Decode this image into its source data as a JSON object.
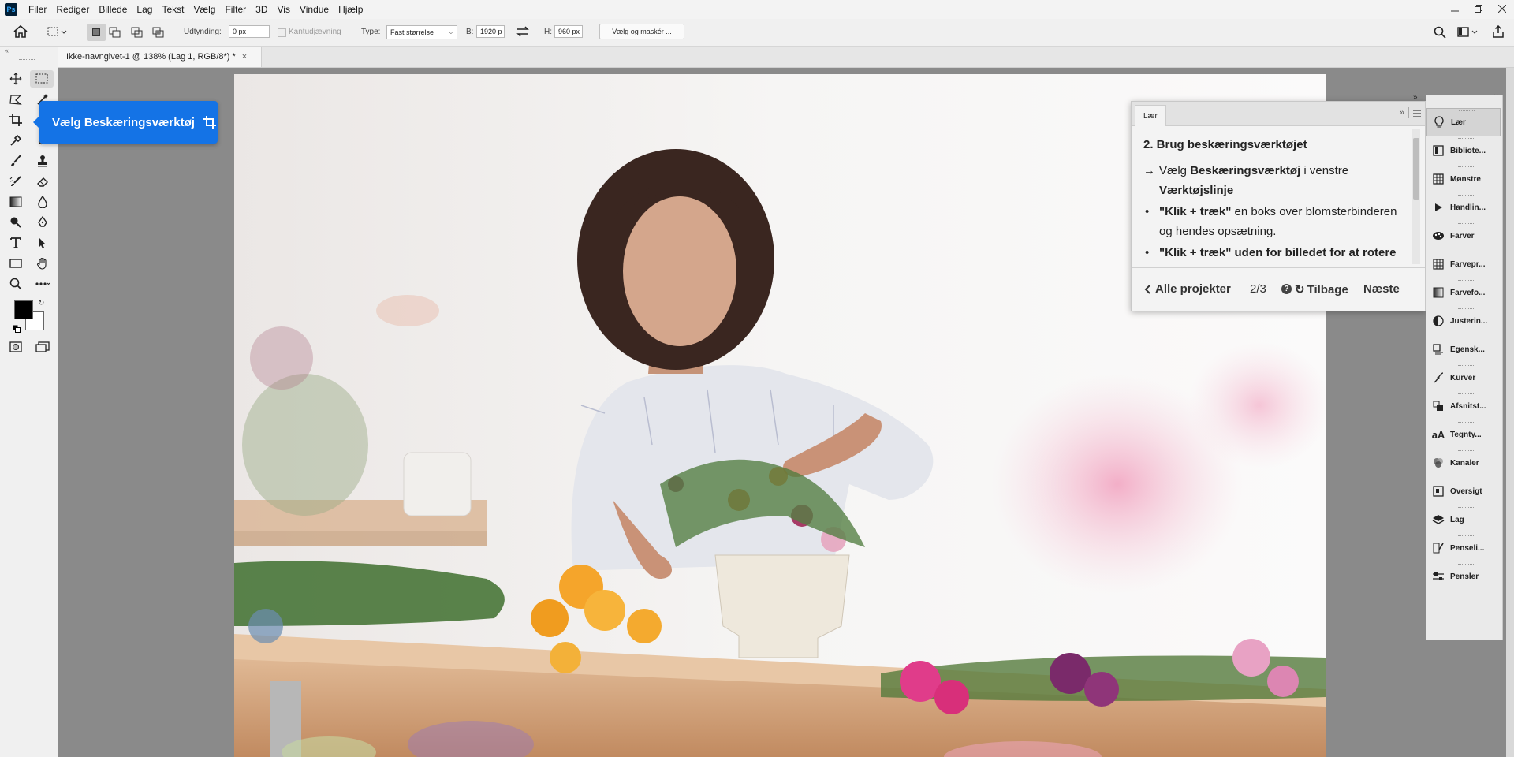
{
  "menubar": {
    "logo": "Ps",
    "items": [
      "Filer",
      "Rediger",
      "Billede",
      "Lag",
      "Tekst",
      "Vælg",
      "Filter",
      "3D",
      "Vis",
      "Vindue",
      "Hjælp"
    ]
  },
  "options": {
    "feather_label": "Udtynding:",
    "feather_value": "0 px",
    "antialias_label": "Kantudjævning",
    "type_label": "Type:",
    "type_value": "Fast størrelse",
    "width_label": "B:",
    "width_value": "1920 p",
    "height_label": "H:",
    "height_value": "960 px",
    "select_mask_label": "Vælg og maskér ..."
  },
  "document": {
    "tab_title": "Ikke-navngivet-1 @ 138% (Lag 1, RGB/8*) *"
  },
  "tooltip": {
    "text": "Vælg Beskæringsværktøj"
  },
  "learn_panel": {
    "tab": "Lær",
    "step_title": "2. Brug beskæringsværktøjet",
    "line1_pre": "Vælg ",
    "line1_bold": "Beskæringsværktøj",
    "line1_post": " i venstre",
    "line1_bold2": "Værktøjslinje",
    "bullet1_bold": "\"Klik + træk\"",
    "bullet1_post": " en boks over blomsterbinderen",
    "bullet1_line2": "og hendes opsætning.",
    "bullet2_cut": "\"Klik + træk\" uden for billedet for at rotere",
    "footer": {
      "all_projects": "Alle projekter",
      "progress": "2/3",
      "back": "Tilbage",
      "next": "Næste"
    }
  },
  "dock": {
    "items": [
      {
        "label": "Lær",
        "icon": "lightbulb-icon"
      },
      {
        "label": "Bibliote...",
        "icon": "library-icon"
      },
      {
        "label": "Mønstre",
        "icon": "patterns-icon"
      },
      {
        "label": "Handlin...",
        "icon": "actions-icon"
      },
      {
        "label": "Farver",
        "icon": "palette-icon"
      },
      {
        "label": "Farvepr...",
        "icon": "swatches-icon"
      },
      {
        "label": "Farvefo...",
        "icon": "gradients-icon"
      },
      {
        "label": "Justerin...",
        "icon": "adjustments-icon"
      },
      {
        "label": "Egensk...",
        "icon": "properties-icon"
      },
      {
        "label": "Kurver",
        "icon": "curves-icon"
      },
      {
        "label": "Afsnitst...",
        "icon": "paragraph-styles-icon"
      },
      {
        "label": "Tegnty...",
        "icon": "character-styles-icon"
      },
      {
        "label": "Kanaler",
        "icon": "channels-icon"
      },
      {
        "label": "Oversigt",
        "icon": "navigator-icon"
      },
      {
        "label": "Lag",
        "icon": "layers-icon"
      },
      {
        "label": "Penseli...",
        "icon": "brush-settings-icon"
      },
      {
        "label": "Pensler",
        "icon": "brushes-icon"
      }
    ]
  }
}
